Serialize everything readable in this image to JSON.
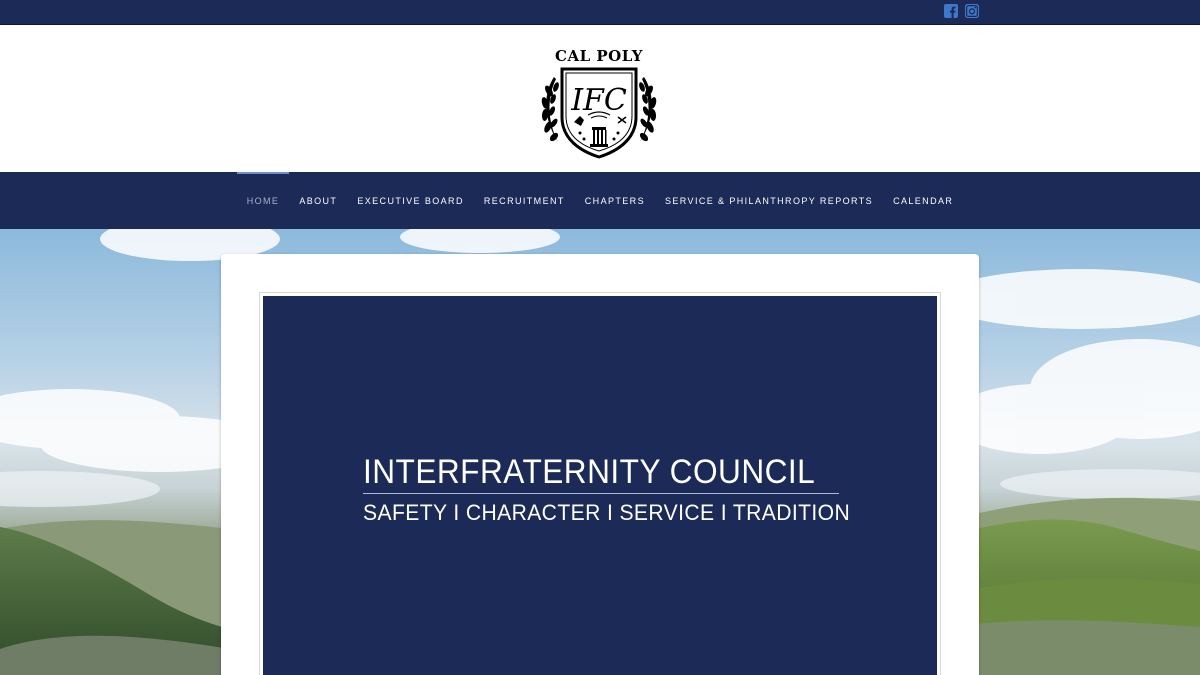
{
  "colors": {
    "navy": "#1b2a56",
    "social_icon": "#3d78c9",
    "active_nav_accent": "#6f8fd0",
    "white": "#ffffff"
  },
  "social": {
    "items": [
      {
        "icon": "facebook-icon"
      },
      {
        "icon": "instagram-icon"
      }
    ]
  },
  "brand": {
    "logo_text": "CAL POLY",
    "logo_monogram": "IFC"
  },
  "nav": {
    "items": [
      {
        "label": "HOME",
        "active": true
      },
      {
        "label": "ABOUT"
      },
      {
        "label": "EXECUTIVE BOARD"
      },
      {
        "label": "RECRUITMENT"
      },
      {
        "label": "CHAPTERS"
      },
      {
        "label": "SERVICE & PHILANTHROPY REPORTS"
      },
      {
        "label": "CALENDAR"
      }
    ]
  },
  "banner": {
    "title": "INTERFRATERNITY COUNCIL",
    "subtitle": "SAFETY I CHARACTER I SERVICE I TRADITION"
  }
}
